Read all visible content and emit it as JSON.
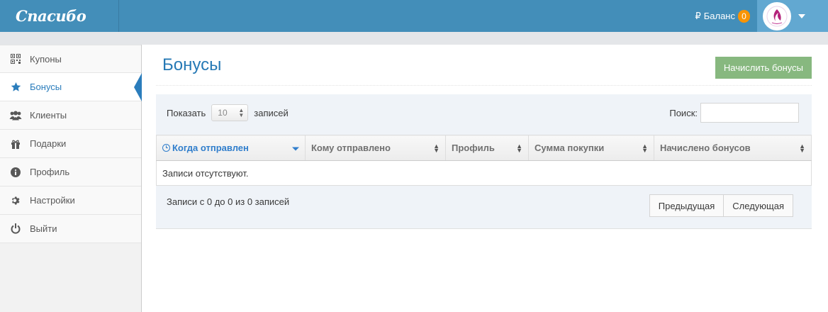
{
  "brand": {
    "name": "Спасибо"
  },
  "header": {
    "currency_symbol": "₽",
    "balance_label": "Баланс",
    "balance_value": "0"
  },
  "sidebar": {
    "items": [
      {
        "label": "Купоны",
        "icon": "qrcode-icon"
      },
      {
        "label": "Бонусы",
        "icon": "star-icon",
        "active": true
      },
      {
        "label": "Клиенты",
        "icon": "users-icon"
      },
      {
        "label": "Подарки",
        "icon": "gift-icon"
      },
      {
        "label": "Профиль",
        "icon": "info-icon"
      },
      {
        "label": "Настройки",
        "icon": "gear-icon"
      },
      {
        "label": "Выйти",
        "icon": "power-icon"
      }
    ]
  },
  "main": {
    "title": "Бонусы",
    "add_button": "Начислить бонусы",
    "length": {
      "label_before": "Показать",
      "value": "10",
      "label_after": "записей"
    },
    "search": {
      "label": "Поиск:",
      "value": ""
    },
    "table": {
      "columns": [
        "Когда отправлен",
        "Кому отправлено",
        "Профиль",
        "Сумма покупки",
        "Начислено бонусов"
      ],
      "empty_text": "Записи отсутствуют."
    },
    "info": "Записи с 0 до 0 из 0 записей",
    "pager": {
      "prev": "Предыдущая",
      "next": "Следующая"
    }
  },
  "colors": {
    "navbar": "#438eb9",
    "title": "#2679b5",
    "button": "#87b87f",
    "badge": "#f89406",
    "active": "#2b7dbc"
  }
}
